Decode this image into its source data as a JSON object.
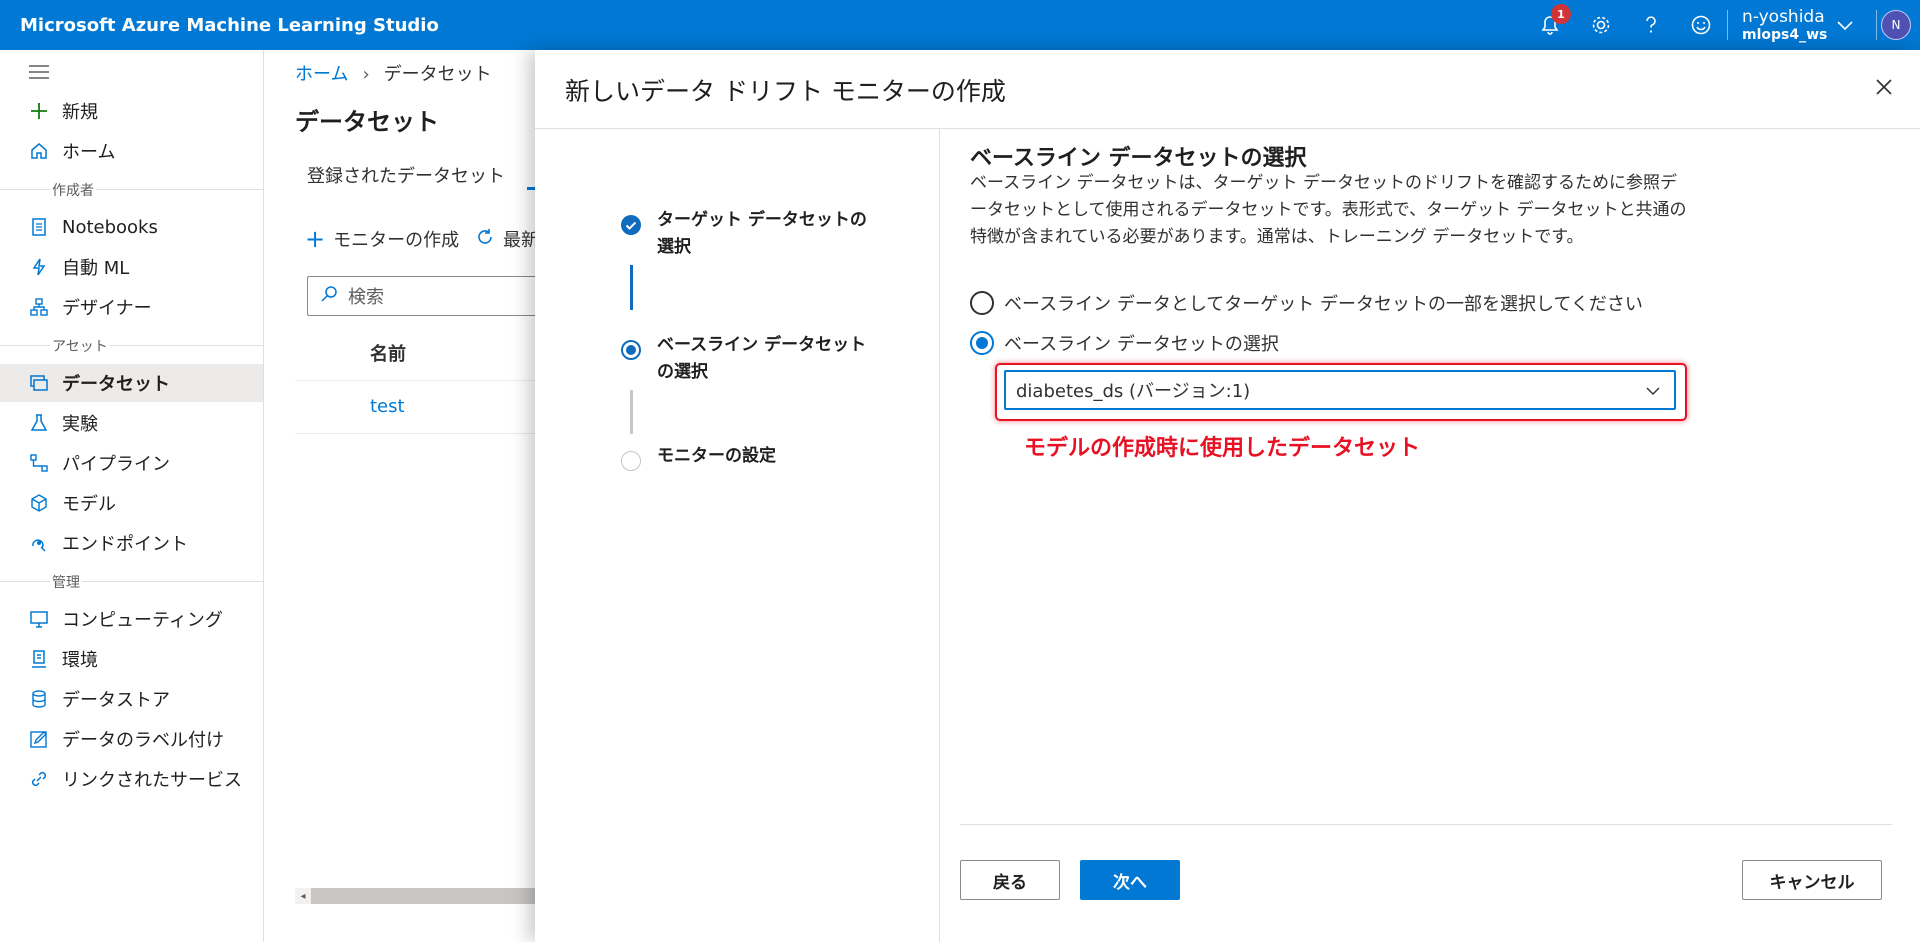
{
  "app": {
    "title": "Microsoft Azure Machine Learning Studio"
  },
  "topbar": {
    "notification_count": "1",
    "user_name": "n-yoshida",
    "workspace": "mlops4_ws",
    "avatar_initial": "N"
  },
  "sidebar": {
    "items": [
      {
        "label": "新規",
        "icon": "plus-icon"
      },
      {
        "label": "ホーム",
        "icon": "home-icon"
      },
      {
        "label": "Notebooks",
        "icon": "notebook-icon"
      },
      {
        "label": "自動 ML",
        "icon": "automl-icon"
      },
      {
        "label": "デザイナー",
        "icon": "designer-icon"
      },
      {
        "label": "データセット",
        "icon": "dataset-icon"
      },
      {
        "label": "実験",
        "icon": "flask-icon"
      },
      {
        "label": "パイプライン",
        "icon": "pipeline-icon"
      },
      {
        "label": "モデル",
        "icon": "cube-icon"
      },
      {
        "label": "エンドポイント",
        "icon": "endpoint-icon"
      },
      {
        "label": "コンピューティング",
        "icon": "monitor-icon"
      },
      {
        "label": "環境",
        "icon": "environment-icon"
      },
      {
        "label": "データストア",
        "icon": "database-icon"
      },
      {
        "label": "データのラベル付け",
        "icon": "edit-icon"
      },
      {
        "label": "リンクされたサービス",
        "icon": "link-icon"
      }
    ],
    "sections": [
      "作成者",
      "アセット",
      "管理"
    ]
  },
  "background": {
    "breadcrumb_home": "ホーム",
    "breadcrumb_current": "データセット",
    "title": "データセット",
    "tab_registered": "登録されたデータセット",
    "cmd_create_monitor": "モニターの作成",
    "cmd_refresh": "最新",
    "search_placeholder": "検索",
    "col_name": "名前",
    "row_name": "test"
  },
  "panel": {
    "title": "新しいデータ ドリフト モニターの作成",
    "steps": [
      {
        "label": "ターゲット データセットの選択",
        "state": "completed"
      },
      {
        "label": "ベースライン データセットの選択",
        "state": "current"
      },
      {
        "label": "モニターの設定",
        "state": "pending"
      }
    ],
    "section_title": "ベースライン データセットの選択",
    "description": "ベースライン データセットは、ターゲット データセットのドリフトを確認するために参照データセットとして使用されるデータセットです。表形式で、ターゲット データセットと共通の特徴が含まれている必要があります。通常は、トレーニング データセットです。",
    "radio_options": [
      {
        "label": "ベースライン データとしてターゲット データセットの一部を選択してください",
        "checked": false
      },
      {
        "label": "ベースライン データセットの選択",
        "checked": true
      }
    ],
    "dropdown_value": "diabetes_ds (バージョン:1)",
    "annotation": "モデルの作成時に使用したデータセット",
    "buttons": {
      "back": "戻る",
      "next": "次へ",
      "cancel": "キャンセル"
    }
  },
  "colors": {
    "accent": "#0078d4",
    "annotation": "#e81123",
    "badge": "#d13438"
  }
}
